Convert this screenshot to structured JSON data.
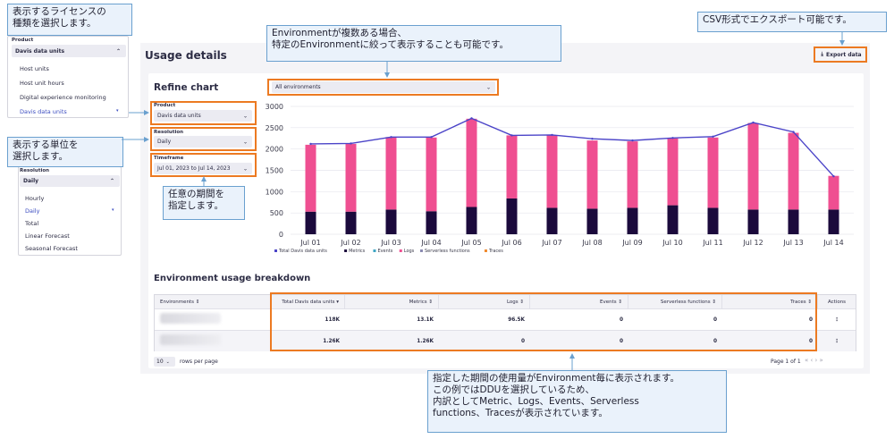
{
  "page": {
    "usage_title": "Usage details",
    "refine_title": "Refine chart",
    "export_label": "Export data",
    "export_icon": "download-icon",
    "env_select": "All environments",
    "breakdown_title": "Environment usage breakdown"
  },
  "filters": {
    "product_label": "Product",
    "product_value": "Davis data units",
    "resolution_label": "Resolution",
    "resolution_value": "Daily",
    "timeframe_label": "Timeframe",
    "timeframe_value": "Jul 01, 2023 to Jul 14, 2023"
  },
  "product_dropdown": {
    "label": "Product",
    "selected": "Davis data units",
    "options": [
      "Host units",
      "Host unit hours",
      "Digital experience monitoring",
      "Davis data units"
    ],
    "selected_index": 3
  },
  "resolution_dropdown": {
    "label": "Resolution",
    "selected": "Daily",
    "options": [
      "Hourly",
      "Daily",
      "Total",
      "Linear Forecast",
      "Seasonal Forecast"
    ],
    "selected_index": 1
  },
  "callouts": {
    "product": "表示するライセンスの\n種類を選択します。",
    "resolution": "表示する単位を\n選択します。",
    "timeframe": "任意の期間を\n指定します。",
    "environment": "Environmentが複数ある場合、\n特定のEnvironmentに絞って表示することも可能です。",
    "export": "CSV形式でエクスポート可能です。",
    "breakdown": "指定した期間の使用量がEnvironment毎に表示されます。\nこの例ではDDUを選択しているため、\n内訳としてMetric、Logs、Events、Serverless\nfunctions、Tracesが表示されています。"
  },
  "table": {
    "headers": [
      "Environments ⇕",
      "Total Davis data units ▾",
      "Metrics ⇕",
      "Logs ⇕",
      "Events ⇕",
      "Serverless functions ⇕",
      "Traces ⇕",
      "Actions"
    ],
    "rows": [
      [
        "118K",
        "13.1K",
        "96.5K",
        "0",
        "0",
        "0"
      ],
      [
        "1.26K",
        "1.26K",
        "0",
        "0",
        "0",
        "0"
      ]
    ],
    "rows_per_page_value": "10",
    "rows_per_page_label": "rows per page",
    "page_info": "Page 1 of 1",
    "pager_glyphs": "«   ‹   ›   »"
  },
  "chart_data": {
    "type": "bar",
    "categories": [
      "Jul 01",
      "Jul 02",
      "Jul 03",
      "Jul 04",
      "Jul 05",
      "Jul 06",
      "Jul 07",
      "Jul 08",
      "Jul 09",
      "Jul 10",
      "Jul 11",
      "Jul 12",
      "Jul 13",
      "Jul 14"
    ],
    "series": [
      {
        "name": "Metrics",
        "kind": "bar",
        "color": "#1b0a3c",
        "values": [
          530,
          530,
          580,
          540,
          640,
          840,
          620,
          600,
          620,
          680,
          620,
          580,
          580,
          580
        ]
      },
      {
        "name": "Logs",
        "kind": "bar",
        "color": "#ef4f91",
        "values": [
          1570,
          1590,
          1700,
          1730,
          2070,
          1480,
          1700,
          1600,
          1560,
          1570,
          1650,
          2030,
          1800,
          790
        ]
      },
      {
        "name": "Total Davis data units",
        "kind": "line",
        "color": "#4b44c8",
        "values": [
          2120,
          2130,
          2280,
          2280,
          2720,
          2320,
          2330,
          2240,
          2200,
          2260,
          2290,
          2620,
          2400,
          1360
        ]
      }
    ],
    "legend": [
      "Total Davis data units",
      "Metrics",
      "Events",
      "Logs",
      "Serverless functions",
      "Traces"
    ],
    "legend_colors": [
      "#4b44c8",
      "#1b0a3c",
      "#3fa6c4",
      "#ef4f91",
      "#8a8ab0",
      "#f08a2e"
    ],
    "ylim": [
      0,
      3000
    ],
    "yticks": [
      0,
      500,
      1000,
      1500,
      2000,
      2500,
      3000
    ],
    "grid": true,
    "legend_position": "bottom-left"
  }
}
